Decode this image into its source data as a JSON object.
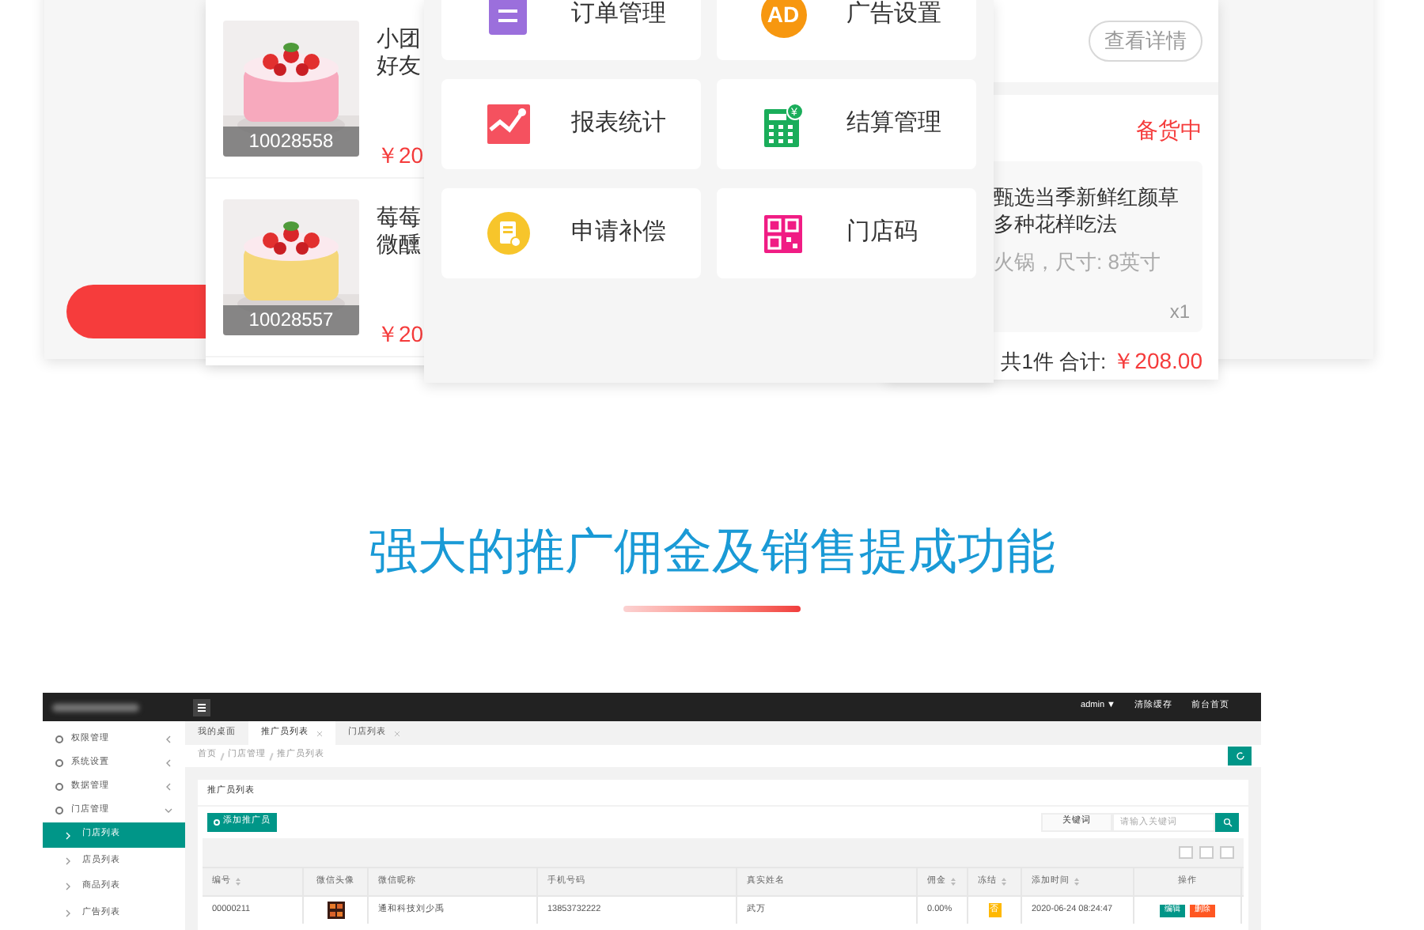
{
  "showcase": {
    "orders": [
      {
        "title_lines": [
          "小团",
          "好友"
        ],
        "price": "￥20",
        "code": "10028558"
      },
      {
        "title_lines": [
          "莓莓",
          "微醺"
        ],
        "price": "￥20",
        "code": "10028557"
      }
    ],
    "menu": [
      {
        "label": "订单管理",
        "kind": "doc",
        "color": "#9b6fdc"
      },
      {
        "label": "广告设置",
        "kind": "ad",
        "color": "#f7970f",
        "icon_text": "AD"
      },
      {
        "label": "报表统计",
        "kind": "chart",
        "color": "#f5515f"
      },
      {
        "label": "结算管理",
        "kind": "calc",
        "color": "#1aad5a",
        "icon_text": "¥"
      },
      {
        "label": "申请补偿",
        "kind": "note",
        "color": "#f7c52b"
      },
      {
        "label": "门店码",
        "kind": "qr",
        "color": "#f01c84"
      }
    ],
    "detail": {
      "button": "查看详情",
      "status": "备货中",
      "name_lines": [
        "甄选当季新鲜红颜草",
        "多种花样吃法"
      ],
      "spec": "火锅，尺寸: 8英寸",
      "qty": "x1",
      "total_label": "共1件  合计:",
      "total": "￥208.00"
    }
  },
  "heading": "强大的推广佣金及销售提成功能",
  "admin": {
    "topbar": {
      "user": "admin ▼",
      "links": [
        "清除缓存",
        "前台首页"
      ]
    },
    "sidebar": [
      {
        "label": "权限管理",
        "expanded": false
      },
      {
        "label": "系统设置",
        "expanded": false
      },
      {
        "label": "数据管理",
        "expanded": false
      },
      {
        "label": "门店管理",
        "expanded": true,
        "children": [
          {
            "label": "门店列表",
            "selected": true
          },
          {
            "label": "店员列表",
            "selected": false
          },
          {
            "label": "商品列表",
            "selected": false
          },
          {
            "label": "广告列表",
            "selected": false
          }
        ]
      }
    ],
    "tabs": [
      {
        "label": "我的桌面",
        "selected": false,
        "closable": false
      },
      {
        "label": "推广员列表",
        "selected": true,
        "closable": true
      },
      {
        "label": "门店列表",
        "selected": false,
        "closable": true
      }
    ],
    "breadcrumb": [
      "首页",
      "门店管理",
      "推广员列表"
    ],
    "panel_title": "推广员列表",
    "add_button": "添加推广员",
    "search": {
      "label": "关键词",
      "placeholder": "请输入关键词"
    },
    "columns": [
      {
        "label": "编号",
        "sortable": true
      },
      {
        "label": "微信头像",
        "sortable": false
      },
      {
        "label": "微信昵称",
        "sortable": false
      },
      {
        "label": "手机号码",
        "sortable": false
      },
      {
        "label": "真实姓名",
        "sortable": false
      },
      {
        "label": "佣金",
        "sortable": true
      },
      {
        "label": "冻结",
        "sortable": true
      },
      {
        "label": "添加时间",
        "sortable": true
      },
      {
        "label": "操作",
        "sortable": false
      }
    ],
    "rows": [
      {
        "id": "00000211",
        "nickname": "通和科技刘少禹",
        "phone": "13853732222",
        "real_name": "武万",
        "commission": "0.00%",
        "frozen": "否",
        "added": "2020-06-24 08:24:47",
        "actions": [
          "编辑",
          "删除"
        ]
      }
    ]
  }
}
